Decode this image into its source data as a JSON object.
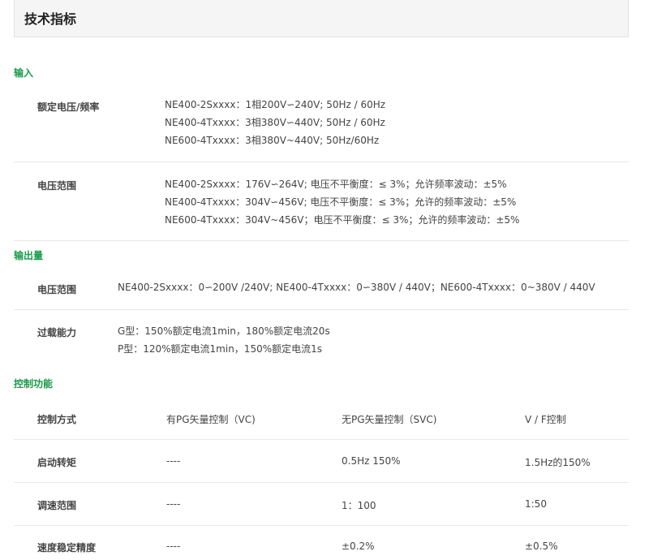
{
  "page_title": "技术指标",
  "sections": {
    "input": {
      "title": "输入",
      "rated": {
        "label": "额定电压/频率",
        "lines": [
          "NE400-2Sxxxx：1相200V∽240V; 50Hz / 60Hz",
          "NE400-4Txxxx：3相380V∽440V; 50Hz / 60Hz",
          "NE600-4Txxxx：3相380V~440V;  50Hz/60Hz"
        ]
      },
      "range": {
        "label": "电压范围",
        "lines": [
          "NE400-2Sxxxx：176V∽264V; 电压不平衡度：≤ 3%；允许频率波动：±5%",
          "NE400-4Txxxx：304V∽456V; 电压不平衡度：≤  3%；允许的频率波动：±5%",
          "NE600-4Txxxx：304V~456V；电压不平衡度：≤  3%；允许的频率波动：±5%"
        ]
      }
    },
    "output": {
      "title": "输出量",
      "voltage": {
        "label": "电压范围",
        "text": "NE400-2Sxxxx：0∽200V /240V; NE400-4Txxxx：0∽380V / 440V；NE600-4Txxxx：0~380V / 440V"
      },
      "overload": {
        "label": "过载能力",
        "lines": [
          "G型：150%额定电流1min，180%额定电流20s",
          "P型：120%额定电流1min，150%额定电流1s"
        ]
      }
    },
    "control": {
      "title": "控制功能",
      "header": [
        "控制方式",
        "有PG矢量控制（VC)",
        "无PG矢量控制（SVC)",
        "V / F控制"
      ],
      "rows": [
        [
          "启动转矩",
          "----",
          "0.5Hz 150%",
          "1.5Hz的150%"
        ],
        [
          "调速范围",
          "----",
          "1：100",
          "1:50"
        ],
        [
          "速度稳定精度",
          "----",
          "±0.2%",
          "±0.5%"
        ]
      ]
    }
  }
}
